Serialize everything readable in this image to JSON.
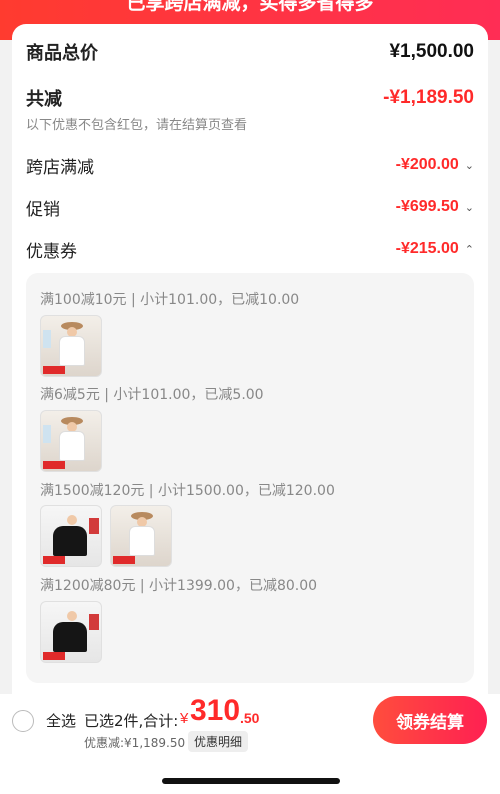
{
  "banner": {
    "text": "已享跨店满减，买得多省得多"
  },
  "summary": {
    "total_label": "商品总价",
    "total_value": "¥1,500.00",
    "reduce_label": "共减",
    "reduce_value": "-¥1,189.50",
    "note": "以下优惠不包含红包，请在结算页查看",
    "lines": [
      {
        "label": "跨店满减",
        "value": "-¥200.00",
        "chevron": "chevron-down-icon"
      },
      {
        "label": "促销",
        "value": "-¥699.50",
        "chevron": "chevron-down-icon"
      },
      {
        "label": "优惠券",
        "value": "-¥215.00",
        "chevron": "chevron-up-icon"
      }
    ]
  },
  "coupons": [
    {
      "title": "满100减10元 | 小计101.00，已减10.00",
      "thumbs": [
        "light"
      ]
    },
    {
      "title": "满6减5元 | 小计101.00，已减5.00",
      "thumbs": [
        "light"
      ]
    },
    {
      "title": "满1500减120元 | 小计1500.00，已减120.00",
      "thumbs": [
        "dark",
        "light"
      ]
    },
    {
      "title": "满1200减80元 | 小计1399.00，已减80.00",
      "thumbs": [
        "dark"
      ]
    }
  ],
  "bottom": {
    "select_all": "全选",
    "selected_summary": "已选2件,合计:",
    "currency": "¥",
    "price_int": "310",
    "price_dec": ".50",
    "discount": "优惠减:¥1,189.50",
    "detail_label": "优惠明细",
    "checkout_label": "领券结算"
  },
  "colors": {
    "accent": "#ff2a2a",
    "button_start": "#ff4d3d",
    "button_end": "#ff2052"
  }
}
